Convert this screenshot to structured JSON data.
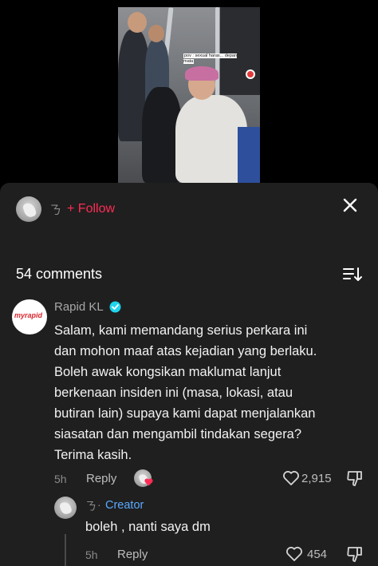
{
  "video": {
    "caption": "pov : sexual haras... depan mata"
  },
  "header": {
    "username_glyph": "ㄋ",
    "follow_label": "+ Follow",
    "close_icon": "close-icon"
  },
  "comments_section": {
    "count_label": "54 comments",
    "sort_icon": "sort-icon"
  },
  "comment": {
    "avatar_text": "myrapid",
    "author": "Rapid KL",
    "verified_icon": "verified-badge-icon",
    "text_lines": [
      "Salam, kami memandang serius perkara ini",
      "dan mohon maaf atas kejadian yang berlaku.",
      "Boleh awak kongsikan maklumat lanjut",
      "berkenaan insiden ini (masa, lokasi, atau",
      "butiran lain) supaya kami dapat menjalankan",
      "siasatan dan mengambil tindakan segera?",
      "Terima kasih."
    ],
    "time": "5h",
    "reply_label": "Reply",
    "like_count": "2,915"
  },
  "reply": {
    "author_glyph": "ㄋ",
    "separator": "·",
    "creator_label": "Creator",
    "text": "boleh , nanti saya dm",
    "time": "5h",
    "reply_label": "Reply",
    "like_count": "454"
  },
  "colors": {
    "follow": "#fe2c55",
    "creator": "#5aa9ff",
    "verified": "#20d5ec",
    "sheet_bg": "#1f1f1f"
  }
}
